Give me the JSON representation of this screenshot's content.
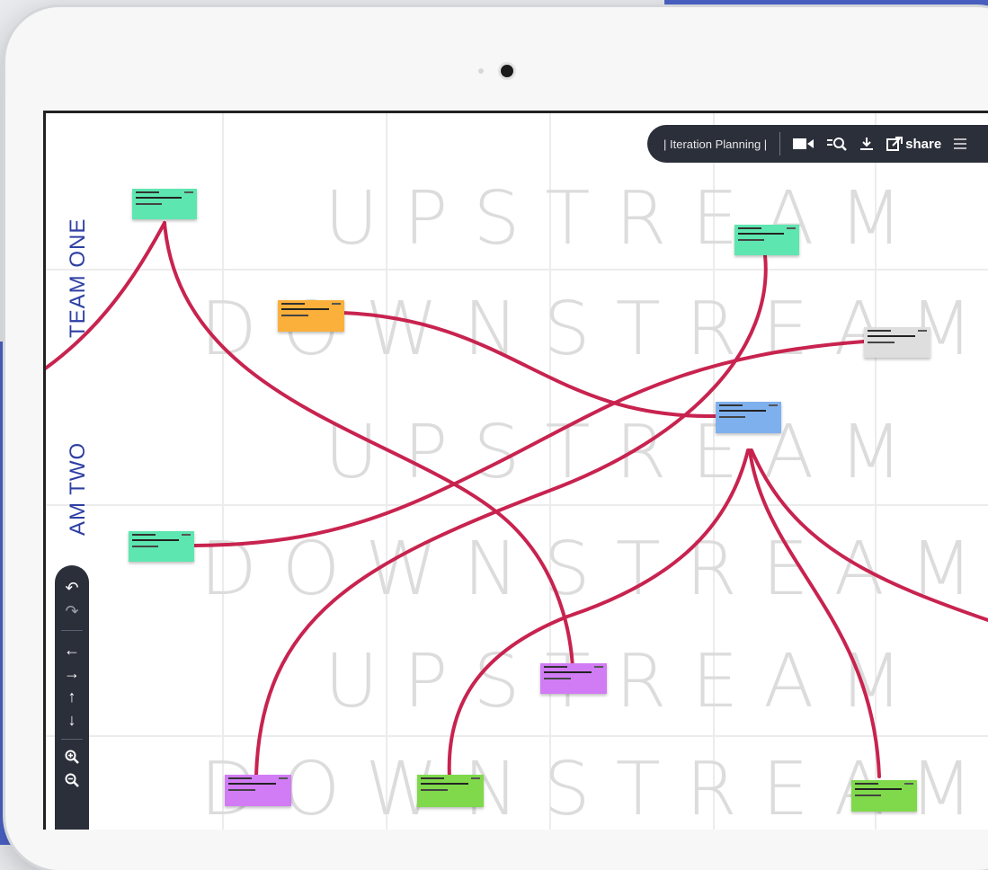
{
  "toolbar": {
    "board_title": "| Iteration Planning |",
    "share_label": "share",
    "icons": [
      "video-icon",
      "search-filter-icon",
      "download-icon",
      "share-icon",
      "menu-icon"
    ]
  },
  "lanes": {
    "team_one": "TEAM ONE",
    "team_two": "AM TWO"
  },
  "watermarks": {
    "row1": "UPSTREAM",
    "row2": "DOWNSTREAM",
    "row3": "UPSTREAM",
    "row4": "DOWNSTREAM",
    "row5": "UPSTREAM",
    "row6": "DOWNSTREAM"
  },
  "left_tools": [
    "undo-icon",
    "redo-icon",
    "arrow-left-icon",
    "arrow-right-icon",
    "arrow-up-icon",
    "arrow-down-icon",
    "zoom-in-icon",
    "zoom-out-icon"
  ],
  "colors": {
    "link": "#c8234f",
    "green": "#5ee6b0",
    "orange": "#fbb03b",
    "grey": "#dedede",
    "blue": "#7fb0ee",
    "purple": "#d17cf5",
    "lime": "#7fd94a",
    "toolbar": "#2b2f3a",
    "lane_text": "#2e3fa3"
  }
}
